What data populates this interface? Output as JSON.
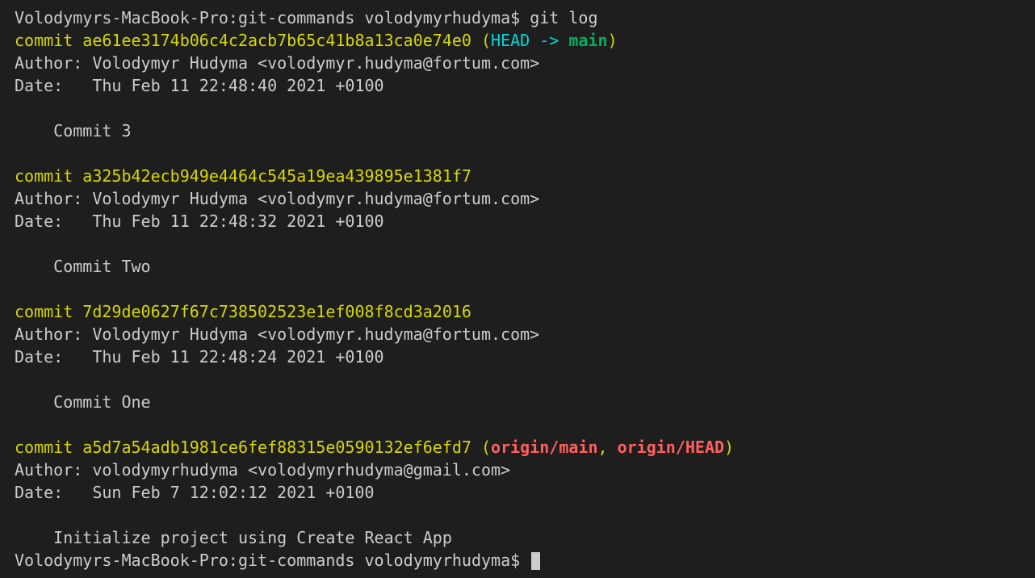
{
  "prompt": {
    "host": "Volodymyrs-MacBook-Pro",
    "path": "git-commands",
    "user": "volodymyrhudyma",
    "symbol": "$"
  },
  "command": "git log",
  "commits": [
    {
      "hash": "ae61ee3174b06c4c2acb7b65c41b8a13ca0e74e0",
      "refs": {
        "head": "HEAD",
        "arrow": "->",
        "branch": "main"
      },
      "author": "Volodymyr Hudyma <volodymyr.hudyma@fortum.com>",
      "date": "Thu Feb 11 22:48:40 2021 +0100",
      "message": "Commit 3"
    },
    {
      "hash": "a325b42ecb949e4464c545a19ea439895e1381f7",
      "author": "Volodymyr Hudyma <volodymyr.hudyma@fortum.com>",
      "date": "Thu Feb 11 22:48:32 2021 +0100",
      "message": "Commit Two"
    },
    {
      "hash": "7d29de0627f67c738502523e1ef008f8cd3a2016",
      "author": "Volodymyr Hudyma <volodymyr.hudyma@fortum.com>",
      "date": "Thu Feb 11 22:48:24 2021 +0100",
      "message": "Commit One"
    },
    {
      "hash": "a5d7a54adb1981ce6fef88315e0590132ef6efd7",
      "remoteRefs": [
        "origin/main",
        "origin/HEAD"
      ],
      "author": "volodymyrhudyma <volodymyrhudyma@gmail.com>",
      "date": "Sun Feb 7 12:02:12 2021 +0100",
      "message": "Initialize project using Create React App"
    }
  ],
  "labels": {
    "commit": "commit ",
    "author": "Author: ",
    "date": "Date:   "
  }
}
